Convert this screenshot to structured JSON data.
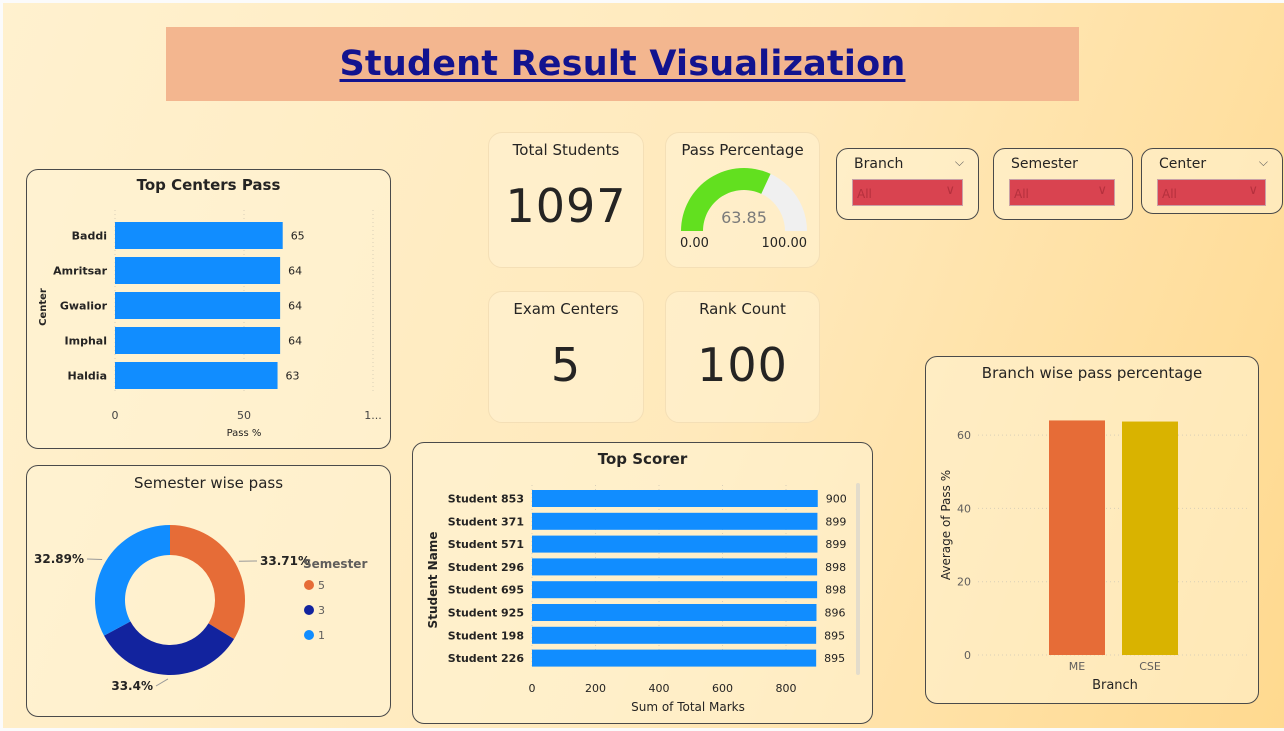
{
  "title": "Student Result Visualization",
  "colors": {
    "bar_blue": "#118dff",
    "me": "#e66c37",
    "cse": "#d9b300",
    "sem5": "#e66c37",
    "sem3": "#12239e",
    "sem1": "#118dff",
    "gauge_fill": "#62e01f",
    "title_bg": "#f3b68f"
  },
  "cards": {
    "total_students": {
      "label": "Total Students",
      "value": "1097"
    },
    "pass_percentage": {
      "label": "Pass Percentage",
      "value": "63.85",
      "min": "0.00",
      "max": "100.00"
    },
    "exam_centers": {
      "label": "Exam Centers",
      "value": "5"
    },
    "rank_count": {
      "label": "Rank Count",
      "value": "100"
    }
  },
  "slicers": [
    {
      "label": "Branch",
      "value": "All"
    },
    {
      "label": "Semester",
      "value": "All"
    },
    {
      "label": "Center",
      "value": "All"
    }
  ],
  "chart_data": [
    {
      "id": "top_centers",
      "type": "bar",
      "orientation": "horizontal",
      "title": "Top Centers Pass",
      "xlabel": "Pass %",
      "ylabel": "Center",
      "categories": [
        "Baddi",
        "Amritsar",
        "Gwalior",
        "Imphal",
        "Haldia"
      ],
      "values": [
        65,
        64,
        64,
        64,
        63
      ],
      "xticks": [
        "0",
        "50",
        "1..."
      ],
      "xlim": [
        0,
        100
      ]
    },
    {
      "id": "semester_pass",
      "type": "pie",
      "title": "Semester wise pass",
      "legend_title": "Semester",
      "legend_position": "right",
      "categories": [
        "5",
        "3",
        "1"
      ],
      "values": [
        33.71,
        33.4,
        32.89
      ],
      "labels": [
        "33.71%",
        "33.4%",
        "32.89%"
      ]
    },
    {
      "id": "top_scorer",
      "type": "bar",
      "orientation": "horizontal",
      "title": "Top Scorer",
      "xlabel": "Sum of Total Marks",
      "ylabel": "Student Name",
      "categories": [
        "Student 853",
        "Student 371",
        "Student 571",
        "Student 296",
        "Student 695",
        "Student 925",
        "Student 198",
        "Student 226"
      ],
      "values": [
        900,
        899,
        899,
        898,
        898,
        896,
        895,
        895
      ],
      "xticks": [
        "0",
        "200",
        "400",
        "600",
        "800"
      ],
      "xlim": [
        0,
        900
      ]
    },
    {
      "id": "branch_pass",
      "type": "bar",
      "title": "Branch wise pass percentage",
      "xlabel": "Branch",
      "ylabel": "Average of Pass %",
      "categories": [
        "ME",
        "CSE"
      ],
      "values": [
        64,
        63.7
      ],
      "yticks": [
        "0",
        "20",
        "40",
        "60"
      ],
      "ylim": [
        0,
        65
      ]
    }
  ]
}
